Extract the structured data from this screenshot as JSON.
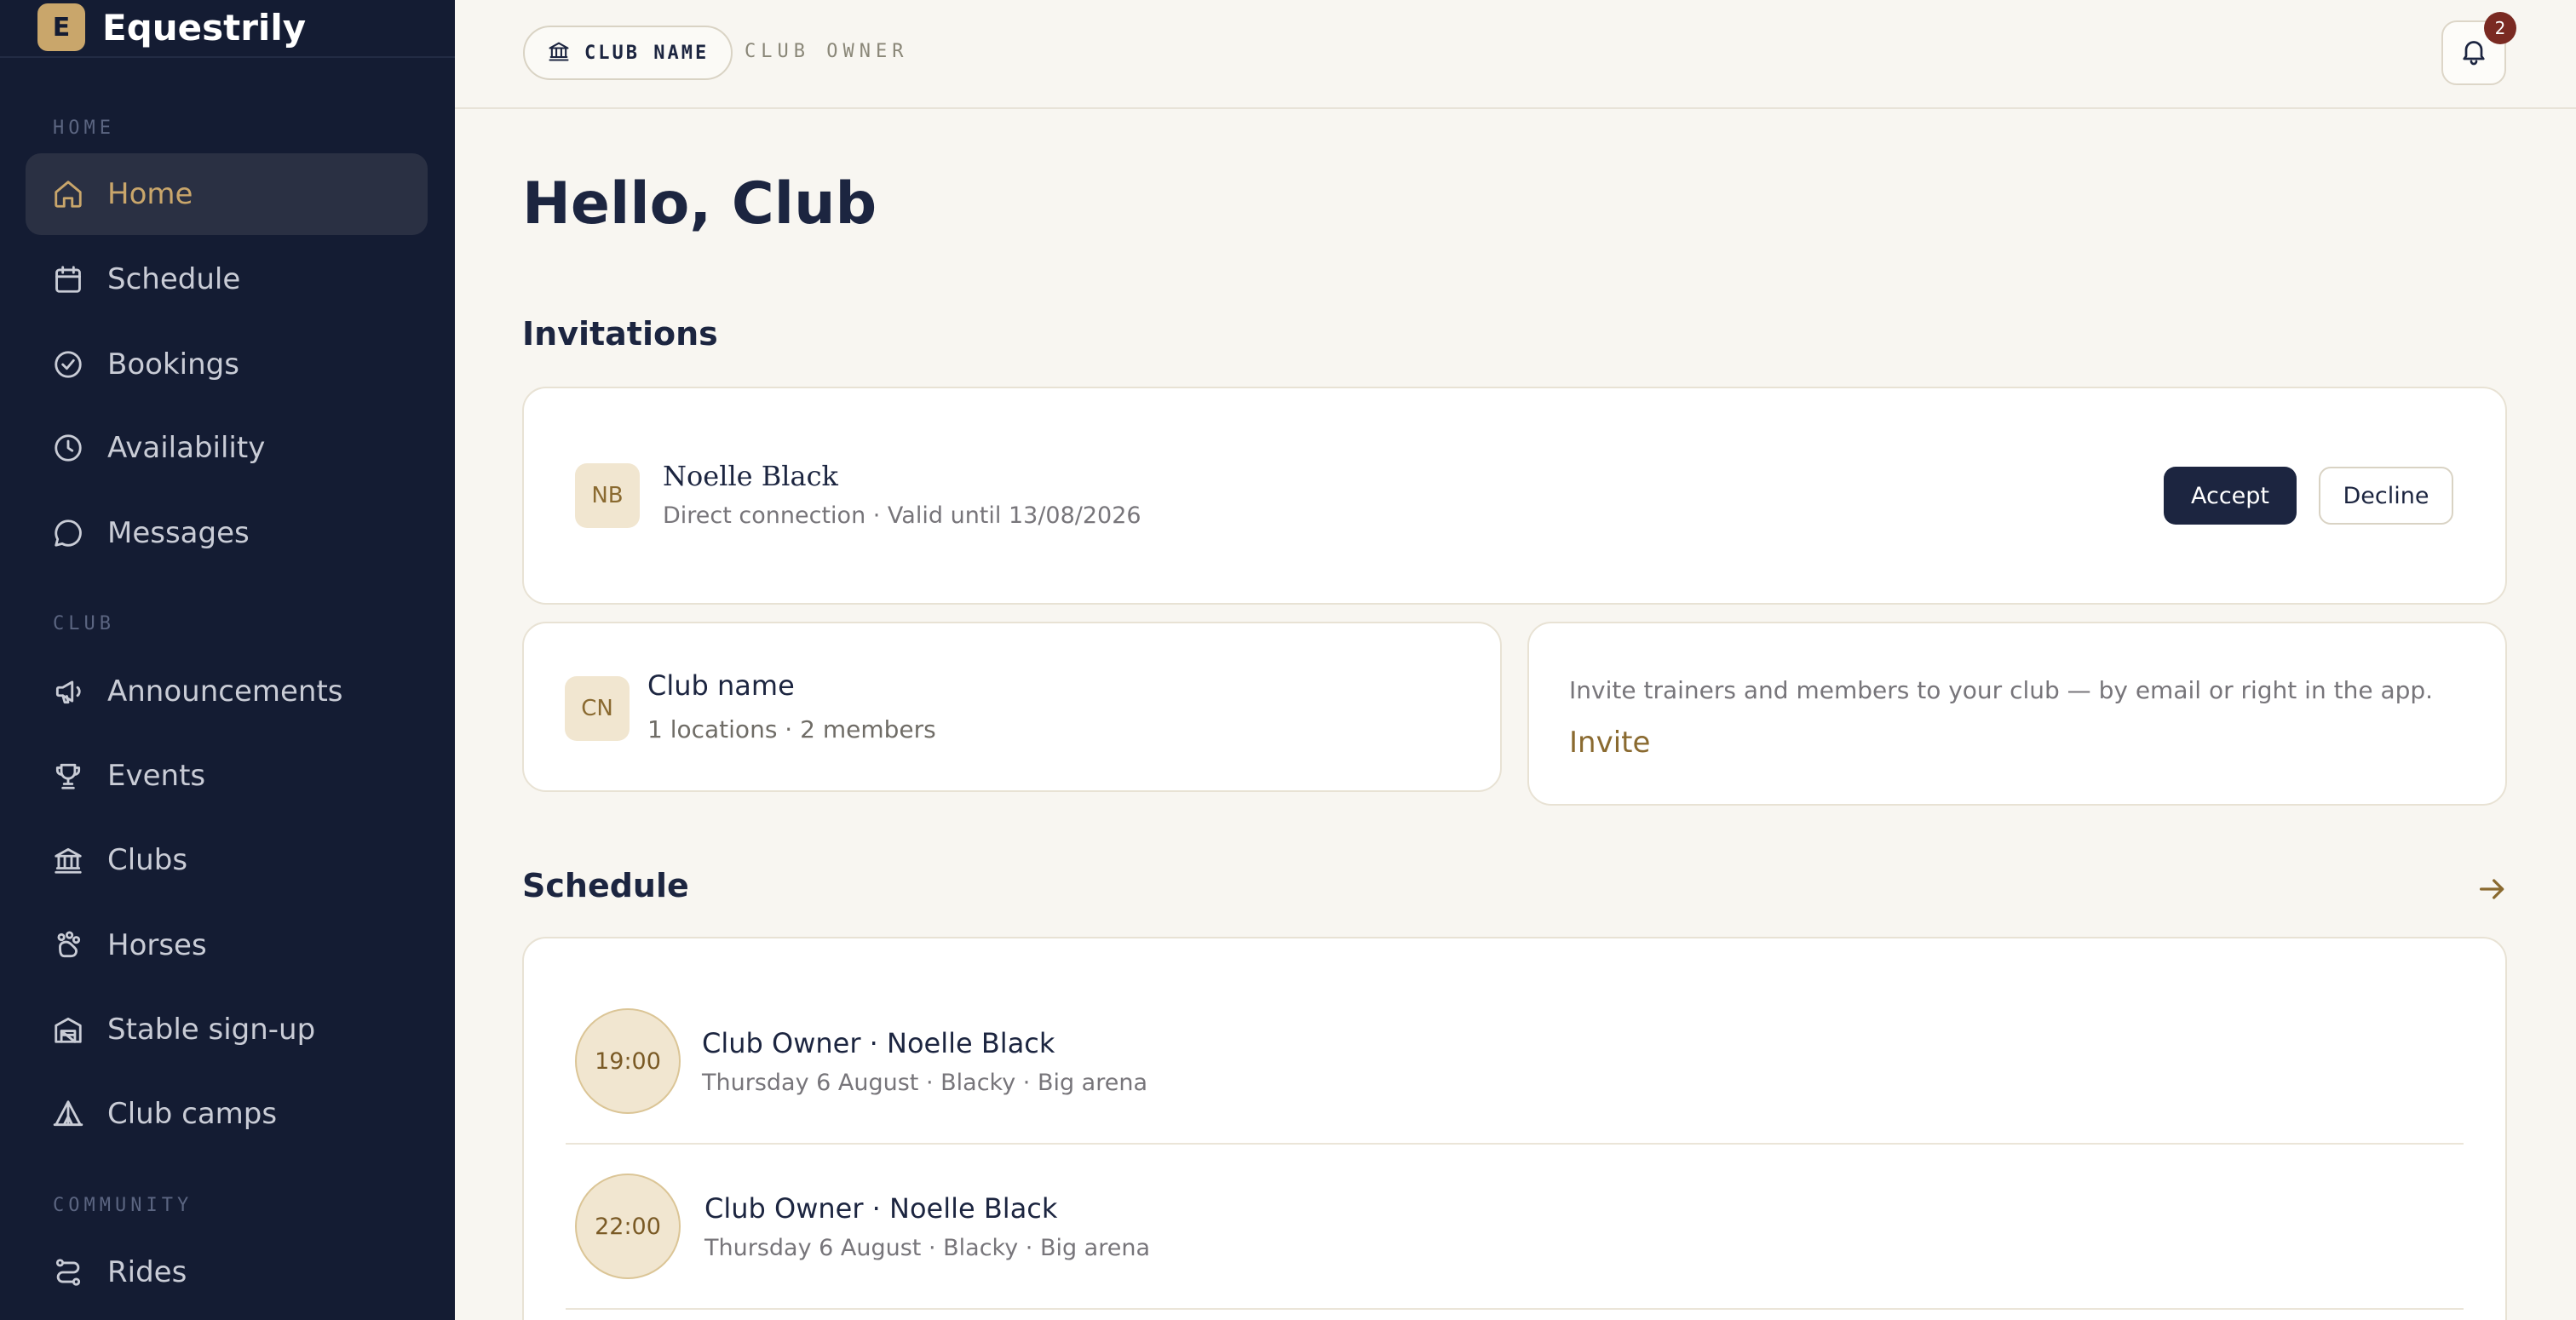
{
  "brand": {
    "logo_letter": "E",
    "name": "Equestrily"
  },
  "sidebar": {
    "sections": [
      "HOME",
      "CLUB",
      "COMMUNITY"
    ],
    "items": [
      {
        "label": "Home",
        "icon": "home-icon",
        "active": true
      },
      {
        "label": "Schedule",
        "icon": "calendar-icon"
      },
      {
        "label": "Bookings",
        "icon": "check-circle-icon"
      },
      {
        "label": "Availability",
        "icon": "clock-icon"
      },
      {
        "label": "Messages",
        "icon": "message-icon"
      },
      {
        "label": "Announcements",
        "icon": "megaphone-icon"
      },
      {
        "label": "Events",
        "icon": "trophy-icon"
      },
      {
        "label": "Clubs",
        "icon": "building-icon"
      },
      {
        "label": "Horses",
        "icon": "paw-icon"
      },
      {
        "label": "Stable sign-up",
        "icon": "stable-icon"
      },
      {
        "label": "Club camps",
        "icon": "tent-icon"
      },
      {
        "label": "Rides",
        "icon": "route-icon"
      }
    ]
  },
  "header": {
    "club_pill": "CLUB NAME",
    "role": "CLUB OWNER",
    "notifications_count": "2"
  },
  "main": {
    "greeting": "Hello, Club",
    "invitations_title": "Invitations",
    "invitation": {
      "initials": "NB",
      "name": "Noelle Black",
      "meta": "Direct connection · Valid until 13/08/2026",
      "accept": "Accept",
      "decline": "Decline"
    },
    "club_card": {
      "initials": "CN",
      "name": "Club name",
      "meta": "1 locations · 2 members"
    },
    "invite_card": {
      "text": "Invite trainers and members to your club — by email or right in the app.",
      "link": "Invite"
    },
    "schedule_title": "Schedule",
    "schedule": [
      {
        "time": "19:00",
        "title": "Club Owner · Noelle Black",
        "meta": "Thursday 6 August · Blacky · Big arena"
      },
      {
        "time": "22:00",
        "title": "Club Owner · Noelle Black",
        "meta": "Thursday 6 August · Blacky · Big arena"
      }
    ]
  },
  "colors": {
    "sidebar_bg": "#141c33",
    "accent_gold": "#c9a66b",
    "navy": "#1c2540",
    "page_bg": "#f8f6f1",
    "badge": "#7a2a22"
  }
}
